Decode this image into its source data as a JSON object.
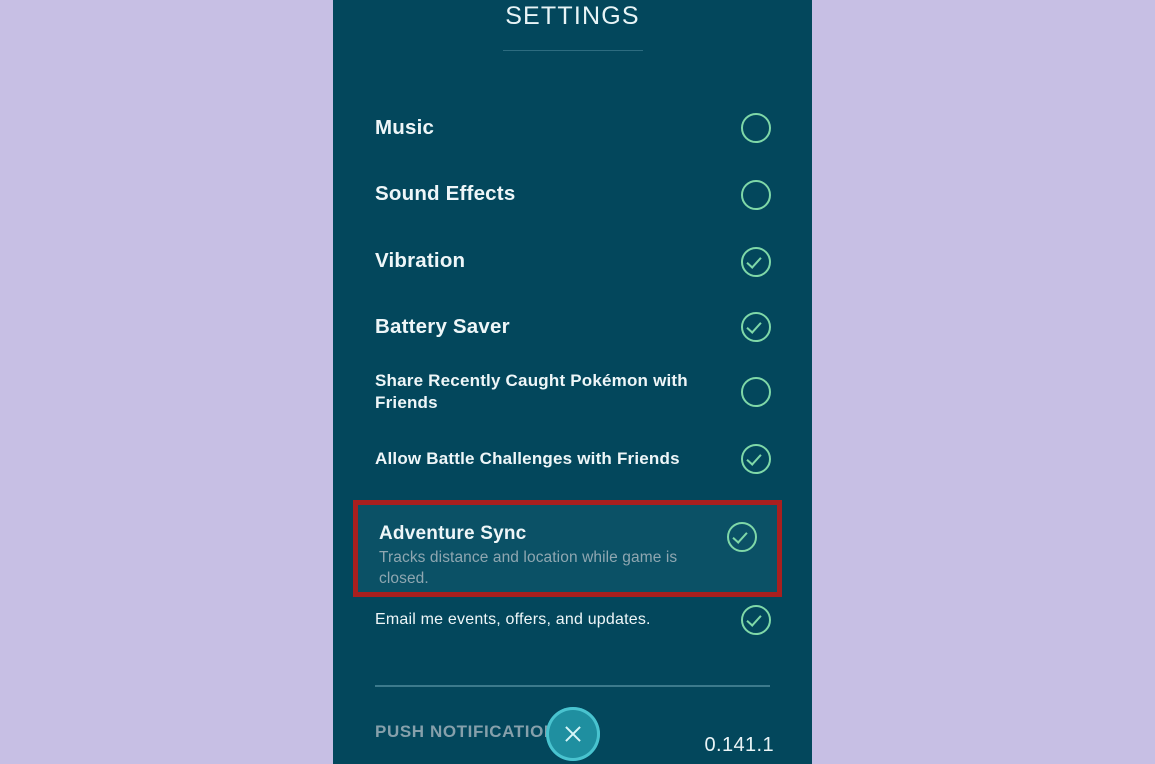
{
  "colors": {
    "page_background": "#c7bfe4",
    "panel_background": "#03475c",
    "accent_green": "#7fd8a8",
    "highlight_red": "#a91f1f",
    "close_button_teal": "#1f8fa0",
    "primary_text": "#eef6f8",
    "muted_text": "#8fa7b1"
  },
  "header": {
    "title": "SETTINGS"
  },
  "settings": {
    "rows": [
      {
        "label": "Music",
        "checked": false,
        "size": "size-lg",
        "row_class": "row-music",
        "name": "setting-row-music"
      },
      {
        "label": "Sound Effects",
        "checked": false,
        "size": "size-lg",
        "row_class": "row-sound",
        "name": "setting-row-sound-effects"
      },
      {
        "label": "Vibration",
        "checked": true,
        "size": "size-lg",
        "row_class": "row-vibration",
        "name": "setting-row-vibration"
      },
      {
        "label": "Battery Saver",
        "checked": true,
        "size": "size-lg",
        "row_class": "row-battery",
        "name": "setting-row-battery-saver"
      },
      {
        "label": "Share Recently Caught Pokémon with Friends",
        "checked": false,
        "size": "size-md",
        "row_class": "row-share",
        "name": "setting-row-share-recently-caught-pokemon"
      },
      {
        "label": "Allow Battle Challenges with Friends",
        "checked": true,
        "size": "size-md",
        "row_class": "row-battlechal",
        "name": "setting-row-allow-battle-challenges"
      },
      {
        "label": "Email me events, offers, and updates.",
        "checked": true,
        "size": "size-sm",
        "row_class": "row-email",
        "name": "setting-row-email-me-events"
      }
    ],
    "adventure_sync": {
      "label": "Adventure Sync",
      "description": "Tracks distance and location while game is closed.",
      "checked": true
    }
  },
  "footer": {
    "push_notifications_label": "PUSH NOTIFICATIONS",
    "version": "0.141.1",
    "close_icon": "close-x-icon"
  }
}
